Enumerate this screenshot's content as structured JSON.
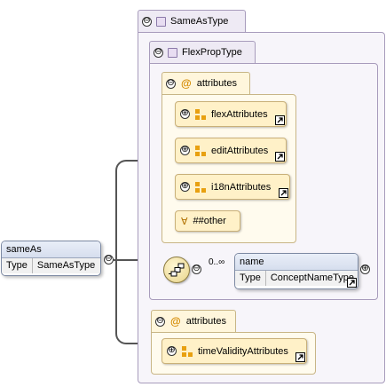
{
  "root_element": {
    "name": "sameAs",
    "type_label": "Type",
    "type_value": "SameAsType",
    "collapse_symbol": "⊖"
  },
  "outer_type": {
    "name": "SameAsType",
    "collapse_symbol": "⊖"
  },
  "inner_type": {
    "name": "FlexPropType",
    "collapse_symbol": "⊖"
  },
  "attribute_group_1": {
    "at_symbol": "@",
    "label": "attributes",
    "collapse_symbol": "⊖",
    "items": [
      {
        "label": "flexAttributes",
        "expand_symbol": "⊕"
      },
      {
        "label": "editAttributes",
        "expand_symbol": "⊕"
      },
      {
        "label": "i18nAttributes",
        "expand_symbol": "⊕"
      }
    ],
    "any_attribute": {
      "symbol": "∀",
      "label": "##other"
    }
  },
  "sequence": {
    "occurrence": "0..∞",
    "collapse_symbol": "⊖"
  },
  "name_element": {
    "name": "name",
    "type_label": "Type",
    "type_value": "ConceptNameType",
    "expand_symbol": "⊕"
  },
  "attribute_group_2": {
    "at_symbol": "@",
    "label": "attributes",
    "collapse_symbol": "⊖",
    "items": [
      {
        "label": "timeValidityAttributes",
        "expand_symbol": "⊕"
      }
    ]
  },
  "colors": {
    "type_fill": "#f7f5fa",
    "attribute_fill": "#fff1c8",
    "element_header": "#d6deee",
    "connector": "#555555"
  }
}
